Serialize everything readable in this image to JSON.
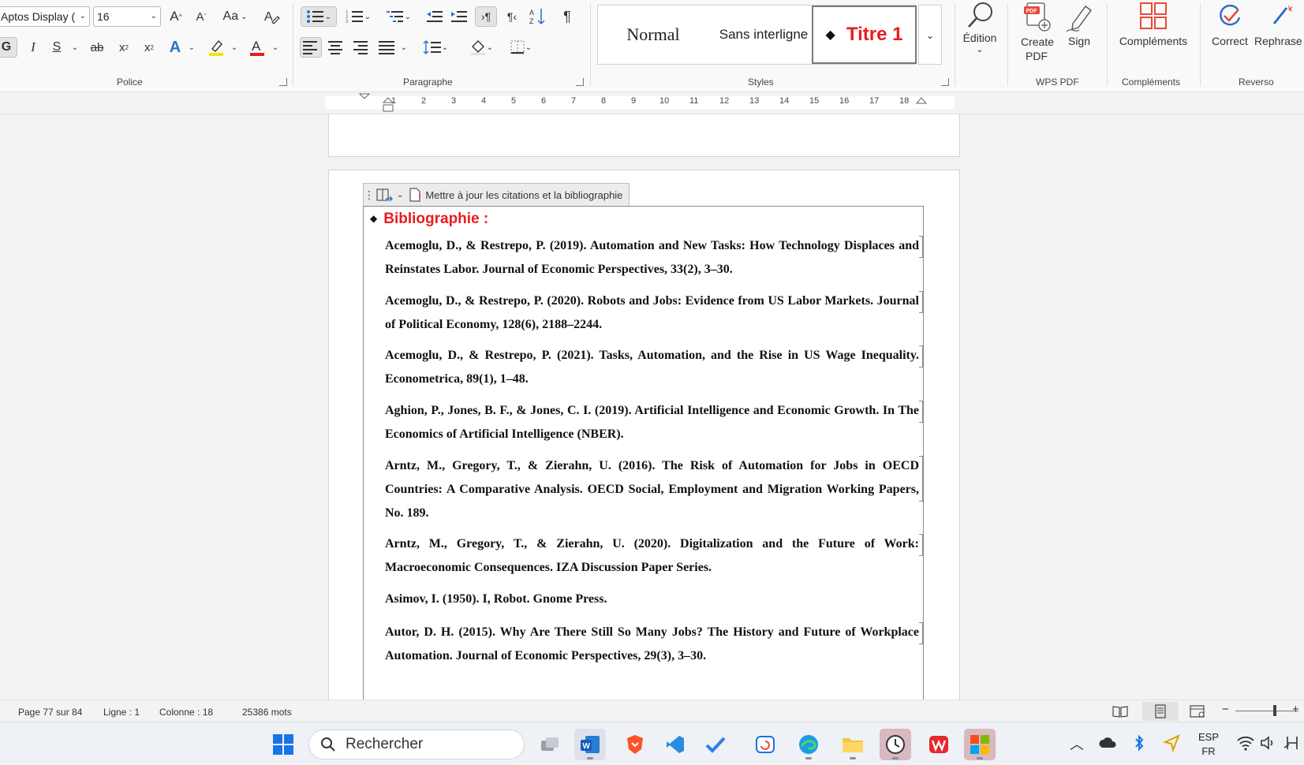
{
  "ribbon": {
    "font_name": "Aptos Display (",
    "font_size": "16",
    "bold_label": "G",
    "italic_label": "I",
    "underline_label": "S",
    "strike_label": "ab",
    "subscript_label": "x",
    "superscript_label": "x",
    "grow_font_label": "A",
    "shrink_font_label": "A",
    "case_label": "Aa",
    "groups": {
      "police": "Police",
      "paragraphe": "Paragraphe",
      "styles": "Styles",
      "wps_pdf": "WPS PDF",
      "complements": "Compléments",
      "reverso": "Reverso"
    },
    "styles": [
      "Normal",
      "Sans interligne",
      "Titre 1"
    ],
    "edition_label": "Édition",
    "create_pdf_label": "Create PDF",
    "pdf_badge": "PDF",
    "sign_label": "Sign",
    "complements_label": "Compléments",
    "correct_label": "Correct",
    "rephrase_label": "Rephrase",
    "accent_red": "#e81d1d"
  },
  "ruler": {
    "numbers": [
      "1",
      "2",
      "3",
      "4",
      "5",
      "6",
      "7",
      "8",
      "9",
      "10",
      "11",
      "12",
      "13",
      "14",
      "15",
      "16",
      "17",
      "18"
    ]
  },
  "document": {
    "cc_tab_label": "Mettre à jour les citations et la bibliographie",
    "heading": "Bibliographie :",
    "entries": [
      "Acemoglu, D., & Restrepo, P. (2019). Automation and New Tasks: How Technology Displaces and Reinstates Labor. Journal of Economic Perspectives, 33(2), 3–30.",
      "Acemoglu, D., & Restrepo, P. (2020). Robots and Jobs: Evidence from US Labor Markets. Journal of Political Economy, 128(6), 2188–2244.",
      "Acemoglu, D., & Restrepo, P. (2021). Tasks, Automation, and the Rise in US Wage Inequality. Econometrica, 89(1), 1–48.",
      "Aghion, P., Jones, B. F., & Jones, C. I. (2019). Artificial Intelligence and Economic Growth. In The Economics of Artificial Intelligence (NBER).",
      "Arntz, M., Gregory, T., & Zierahn, U. (2016). The Risk of Automation for Jobs in OECD Countries: A Comparative Analysis. OECD Social, Employment and Migration Working Papers, No. 189.",
      "Arntz, M., Gregory, T., & Zierahn, U. (2020). Digitalization and the Future of Work: Macroeconomic Consequences. IZA Discussion Paper Series.",
      "Asimov, I. (1950). I, Robot. Gnome Press.",
      "Autor, D. H. (2015). Why Are There Still So Many Jobs? The History and Future of Workplace Automation. Journal of Economic Perspectives, 29(3), 3–30."
    ]
  },
  "status": {
    "page": "Page 77 sur 84",
    "line": "Ligne : 1",
    "column": "Colonne : 18",
    "words": "25386 mots"
  },
  "taskbar": {
    "search_placeholder": "Rechercher",
    "lang_top": "ESP",
    "lang_bottom": "FR"
  }
}
